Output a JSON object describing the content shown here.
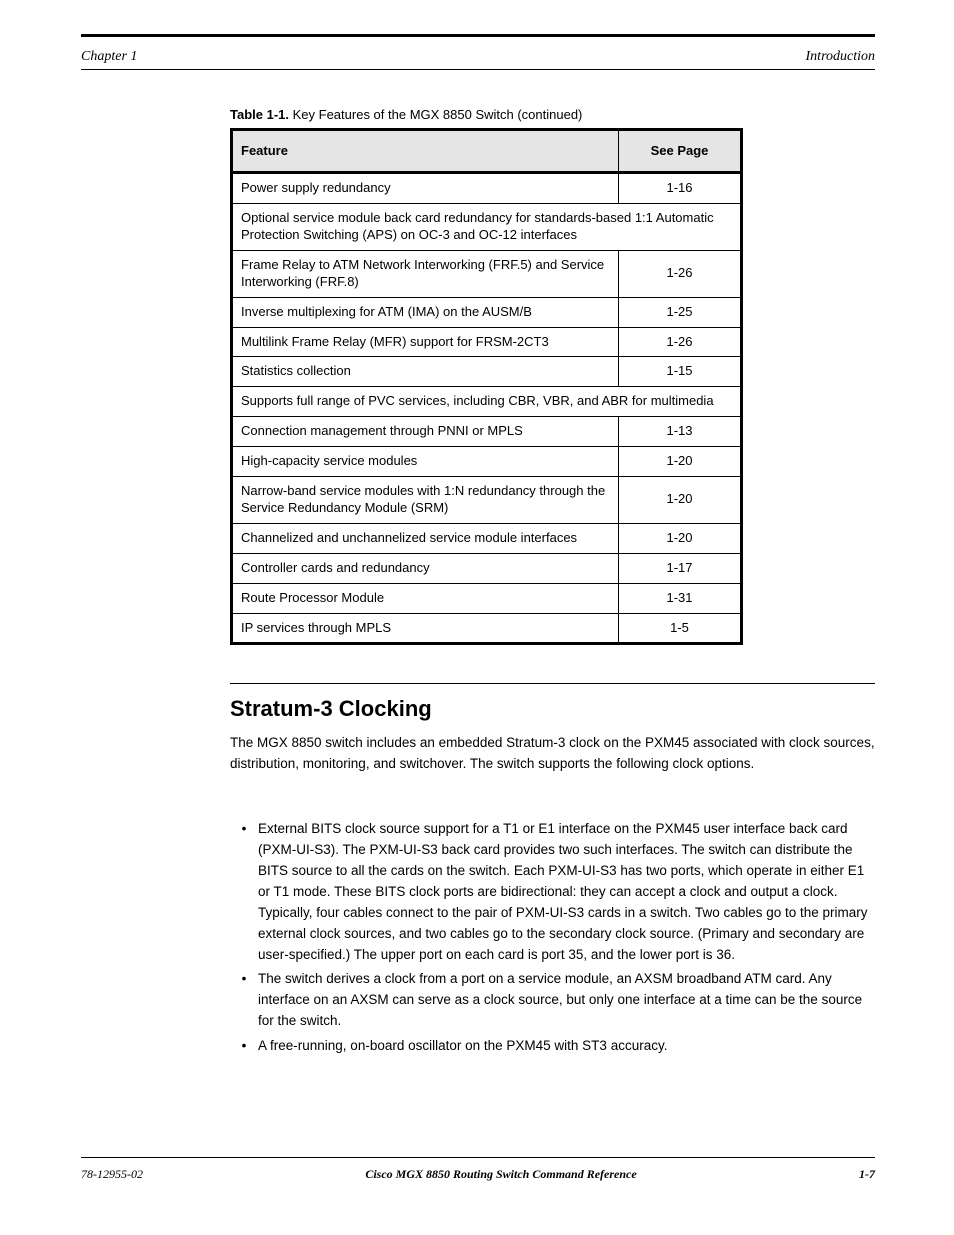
{
  "header": {
    "left": "Chapter 1",
    "right": "Introduction"
  },
  "caption": {
    "label": "Table 1-1.",
    "text": " Key Features of the MGX 8850 Switch (continued)"
  },
  "table": {
    "head": {
      "feature": "Feature",
      "page": "See Page"
    },
    "rows": [
      {
        "type": "row",
        "feature": "Power supply redundancy",
        "page": "1-16"
      },
      {
        "type": "span",
        "feature": "Optional service module back card redundancy for standards-based 1:1 Automatic Protection Switching (APS) on OC-3 and OC-12 interfaces"
      },
      {
        "type": "row",
        "feature": "Frame Relay to ATM Network Interworking (FRF.5) and Service Interworking (FRF.8)",
        "page": "1-26"
      },
      {
        "type": "row",
        "feature": "Inverse multiplexing for ATM (IMA) on the AUSM/B",
        "page": "1-25"
      },
      {
        "type": "row",
        "feature": "Multilink Frame Relay (MFR) support for FRSM-2CT3",
        "page": "1-26"
      },
      {
        "type": "row",
        "feature": "Statistics collection",
        "page": "1-15"
      },
      {
        "type": "span",
        "feature": "Supports full range of PVC services, including CBR, VBR, and ABR for multimedia"
      },
      {
        "type": "row",
        "feature": "Connection management through PNNI or MPLS",
        "page": "1-13"
      },
      {
        "type": "row",
        "feature": "High-capacity service modules",
        "page": "1-20"
      },
      {
        "type": "row",
        "feature": "Narrow-band service modules with 1:N redundancy through the Service Redundancy Module (SRM)",
        "page": "1-20"
      },
      {
        "type": "row",
        "feature": "Channelized and unchannelized service module interfaces",
        "page": "1-20"
      },
      {
        "type": "row",
        "feature": "Controller cards and redundancy",
        "page": "1-17"
      },
      {
        "type": "row",
        "feature": "Route Processor Module",
        "page": "1-31"
      },
      {
        "type": "row",
        "feature": "IP services through MPLS",
        "page": "1-5"
      }
    ]
  },
  "section": {
    "title": "Stratum-3 Clocking",
    "para": "The MGX 8850 switch includes an embedded Stratum-3 clock on the PXM45 associated with clock sources, distribution, monitoring, and switchover. The switch supports the following clock options.",
    "bullets": [
      "External BITS clock source support for a T1 or E1 interface on the PXM45 user interface back card (PXM-UI-S3). The PXM-UI-S3 back card provides two such interfaces. The switch can distribute the BITS source to all the cards on the switch. Each PXM-UI-S3 has two ports, which operate in either E1 or T1 mode. These BITS clock ports are bidirectional: they can accept a clock and output a clock. Typically, four cables connect to the pair of PXM-UI-S3 cards in a switch. Two cables go to the primary external clock sources, and two cables go to the secondary clock source. (Primary and secondary are user-specified.) The upper port on each card is port 35, and the lower port is 36.",
      "The switch derives a clock from a port on a service module, an AXSM broadband ATM card. Any interface on an AXSM can serve as a clock source, but only one interface at a time can be the source for the switch.",
      "A free-running, on-board oscillator on the PXM45 with ST3 accuracy."
    ]
  },
  "footer": {
    "left": "78-12955-02",
    "center": "Cisco MGX 8850 Routing Switch Command Reference",
    "right": "1-7"
  }
}
